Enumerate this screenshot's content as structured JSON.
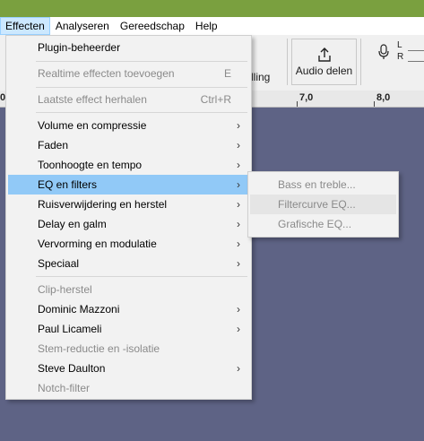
{
  "menubar": {
    "items": [
      "Effecten",
      "Analyseren",
      "Gereedschap",
      "Help"
    ]
  },
  "toolbar": {
    "partial_label": "lling",
    "share_label": "Audio delen",
    "meter_left": "L",
    "meter_right": "R",
    "share_icon": "share-upload-icon",
    "mic_icon": "microphone-icon"
  },
  "ruler": {
    "ticks": [
      "0",
      "7,0",
      "8,0"
    ]
  },
  "colors": {
    "title_strip": "#7aa03f",
    "highlight": "#91c9f7",
    "track_background": "#5e6385"
  },
  "menu": {
    "items": [
      {
        "label": "Plugin-beheerder"
      },
      {
        "label": "Realtime effecten toevoegen",
        "shortcut": "E"
      },
      {
        "label": "Laatste effect herhalen",
        "shortcut": "Ctrl+R"
      },
      {
        "label": "Volume en compressie",
        "arrow": "›"
      },
      {
        "label": "Faden",
        "arrow": "›"
      },
      {
        "label": "Toonhoogte en tempo",
        "arrow": "›"
      },
      {
        "label": "EQ en filters",
        "arrow": "›"
      },
      {
        "label": "Ruisverwijdering en herstel",
        "arrow": "›"
      },
      {
        "label": "Delay en galm",
        "arrow": "›"
      },
      {
        "label": "Vervorming en modulatie",
        "arrow": "›"
      },
      {
        "label": "Speciaal",
        "arrow": "›"
      },
      {
        "label": "Clip-herstel"
      },
      {
        "label": "Dominic Mazzoni",
        "arrow": "›"
      },
      {
        "label": "Paul Licameli",
        "arrow": "›"
      },
      {
        "label": "Stem-reductie en -isolatie"
      },
      {
        "label": "Steve Daulton",
        "arrow": "›"
      },
      {
        "label": "Notch-filter"
      }
    ]
  },
  "submenu": {
    "items": [
      "Bass en treble...",
      "Filtercurve EQ...",
      "Grafische EQ..."
    ]
  }
}
